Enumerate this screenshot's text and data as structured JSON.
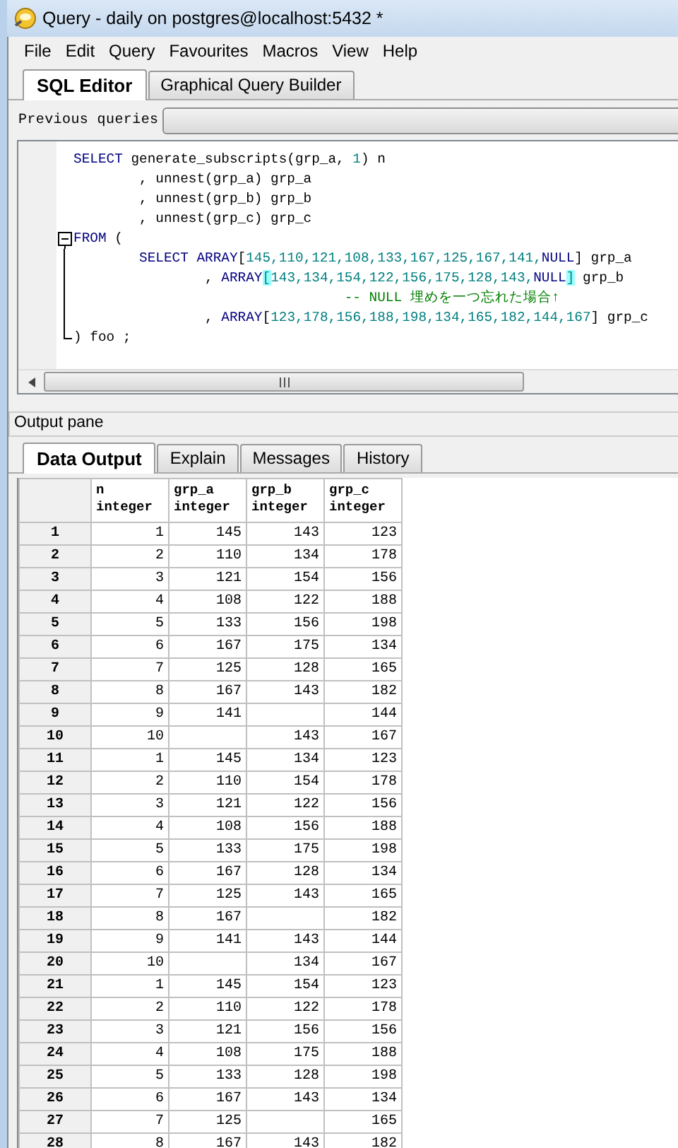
{
  "window": {
    "title": "Query - daily on postgres@localhost:5432 *"
  },
  "menu": [
    "File",
    "Edit",
    "Query",
    "Favourites",
    "Macros",
    "View",
    "Help"
  ],
  "editor_tabs": [
    {
      "label": "SQL Editor",
      "selected": true
    },
    {
      "label": "Graphical Query Builder",
      "selected": false
    }
  ],
  "previous_queries": {
    "label": "Previous queries"
  },
  "sql_lines": [
    {
      "segments": [
        {
          "kind": "keyword",
          "text": "SELECT"
        },
        {
          "kind": "plain",
          "text": " generate_subscripts(grp_a, "
        },
        {
          "kind": "number",
          "text": "1"
        },
        {
          "kind": "plain",
          "text": ") n"
        }
      ]
    },
    {
      "segments": [
        {
          "kind": "plain",
          "text": "        , unnest(grp_a) grp_a"
        }
      ]
    },
    {
      "segments": [
        {
          "kind": "plain",
          "text": "        , unnest(grp_b) grp_b"
        }
      ]
    },
    {
      "segments": [
        {
          "kind": "plain",
          "text": "        , unnest(grp_c) grp_c"
        }
      ]
    },
    {
      "expanded": true,
      "segments": [
        {
          "kind": "keyword",
          "text": "FROM"
        },
        {
          "kind": "plain",
          "text": " ("
        }
      ],
      "children": [
        {
          "segments": [
            {
              "kind": "keyword",
              "text": "        SELECT ARRAY"
            },
            {
              "kind": "plain",
              "text": "["
            },
            {
              "kind": "number",
              "text": "145,110,121,108,133,167,125,167,141,"
            },
            {
              "kind": "keyword",
              "text": "NULL"
            },
            {
              "kind": "plain",
              "text": "] grp_a"
            }
          ]
        },
        {
          "segments": [
            {
              "kind": "plain",
              "text": "                , "
            },
            {
              "kind": "keyword",
              "text": "ARRAY"
            },
            {
              "kind": "match",
              "text": "["
            },
            {
              "kind": "number",
              "text": "143,134,154,122,156,175,128,143,"
            },
            {
              "kind": "keyword",
              "text": "NULL"
            },
            {
              "kind": "match",
              "text": "]"
            },
            {
              "kind": "plain",
              "text": " grp_b"
            }
          ]
        },
        {
          "segments": [
            {
              "kind": "comment",
              "text": "                                 -- NULL 埋めを一つ忘れた場合↑"
            }
          ]
        },
        {
          "segments": [
            {
              "kind": "plain",
              "text": "                , "
            },
            {
              "kind": "keyword",
              "text": "ARRAY"
            },
            {
              "kind": "plain",
              "text": "["
            },
            {
              "kind": "number",
              "text": "123,178,156,188,198,134,165,182,144,167"
            },
            {
              "kind": "plain",
              "text": "] grp_c"
            }
          ]
        },
        {
          "segments": [
            {
              "kind": "plain",
              "text": ") foo ;"
            }
          ]
        }
      ]
    }
  ],
  "output_pane": {
    "title": "Output pane"
  },
  "output_tabs": [
    {
      "label": "Data Output",
      "selected": true
    },
    {
      "label": "Explain",
      "selected": false
    },
    {
      "label": "Messages",
      "selected": false
    },
    {
      "label": "History",
      "selected": false
    }
  ],
  "table": {
    "columns": [
      {
        "name": "n",
        "type": "integer"
      },
      {
        "name": "grp_a",
        "type": "integer"
      },
      {
        "name": "grp_b",
        "type": "integer"
      },
      {
        "name": "grp_c",
        "type": "integer"
      }
    ],
    "rows": [
      {
        "row": "1",
        "n": "1",
        "grp_a": "145",
        "grp_b": "143",
        "grp_c": "123"
      },
      {
        "row": "2",
        "n": "2",
        "grp_a": "110",
        "grp_b": "134",
        "grp_c": "178"
      },
      {
        "row": "3",
        "n": "3",
        "grp_a": "121",
        "grp_b": "154",
        "grp_c": "156"
      },
      {
        "row": "4",
        "n": "4",
        "grp_a": "108",
        "grp_b": "122",
        "grp_c": "188"
      },
      {
        "row": "5",
        "n": "5",
        "grp_a": "133",
        "grp_b": "156",
        "grp_c": "198"
      },
      {
        "row": "6",
        "n": "6",
        "grp_a": "167",
        "grp_b": "175",
        "grp_c": "134"
      },
      {
        "row": "7",
        "n": "7",
        "grp_a": "125",
        "grp_b": "128",
        "grp_c": "165"
      },
      {
        "row": "8",
        "n": "8",
        "grp_a": "167",
        "grp_b": "143",
        "grp_c": "182"
      },
      {
        "row": "9",
        "n": "9",
        "grp_a": "141",
        "grp_c": "144"
      },
      {
        "row": "10",
        "n": "10",
        "grp_b": "143",
        "grp_c": "167"
      },
      {
        "row": "11",
        "n": "1",
        "grp_a": "145",
        "grp_b": "134",
        "grp_c": "123"
      },
      {
        "row": "12",
        "n": "2",
        "grp_a": "110",
        "grp_b": "154",
        "grp_c": "178"
      },
      {
        "row": "13",
        "n": "3",
        "grp_a": "121",
        "grp_b": "122",
        "grp_c": "156"
      },
      {
        "row": "14",
        "n": "4",
        "grp_a": "108",
        "grp_b": "156",
        "grp_c": "188"
      },
      {
        "row": "15",
        "n": "5",
        "grp_a": "133",
        "grp_b": "175",
        "grp_c": "198"
      },
      {
        "row": "16",
        "n": "6",
        "grp_a": "167",
        "grp_b": "128",
        "grp_c": "134"
      },
      {
        "row": "17",
        "n": "7",
        "grp_a": "125",
        "grp_b": "143",
        "grp_c": "165"
      },
      {
        "row": "18",
        "n": "8",
        "grp_a": "167",
        "grp_c": "182"
      },
      {
        "row": "19",
        "n": "9",
        "grp_a": "141",
        "grp_b": "143",
        "grp_c": "144"
      },
      {
        "row": "20",
        "n": "10",
        "grp_b": "134",
        "grp_c": "167"
      },
      {
        "row": "21",
        "n": "1",
        "grp_a": "145",
        "grp_b": "154",
        "grp_c": "123"
      },
      {
        "row": "22",
        "n": "2",
        "grp_a": "110",
        "grp_b": "122",
        "grp_c": "178"
      },
      {
        "row": "23",
        "n": "3",
        "grp_a": "121",
        "grp_b": "156",
        "grp_c": "156"
      },
      {
        "row": "24",
        "n": "4",
        "grp_a": "108",
        "grp_b": "175",
        "grp_c": "188"
      },
      {
        "row": "25",
        "n": "5",
        "grp_a": "133",
        "grp_b": "128",
        "grp_c": "198"
      },
      {
        "row": "26",
        "n": "6",
        "grp_a": "167",
        "grp_b": "143",
        "grp_c": "134"
      },
      {
        "row": "27",
        "n": "7",
        "grp_a": "125",
        "grp_c": "165"
      },
      {
        "row": "28",
        "n": "8",
        "grp_a": "167",
        "grp_b": "143",
        "grp_c": "182"
      }
    ]
  }
}
